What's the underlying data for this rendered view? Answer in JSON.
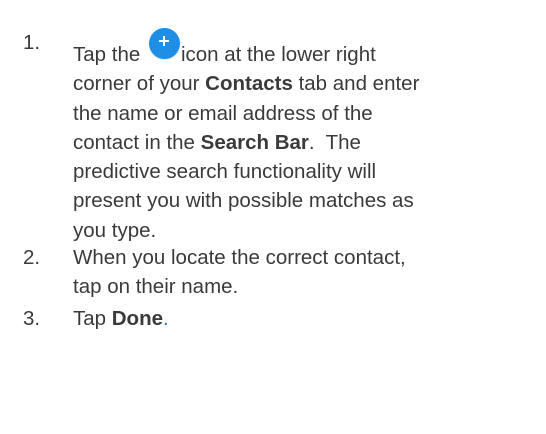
{
  "steps": [
    {
      "number": "1.",
      "lines": [
        {
          "a": "Tap the",
          "b": "icon at the lower right"
        },
        {
          "a": "corner of your ",
          "bold": "Contacts",
          "c": " tab and enter"
        },
        {
          "a": "the name or email address of the"
        },
        {
          "a": "contact in the ",
          "bold": "Search Bar",
          "c": ".  The"
        },
        {
          "a": "predictive search functionality will"
        },
        {
          "a": "present you with possible matches as"
        },
        {
          "a": "you type."
        }
      ],
      "icon": "plus-circle-icon",
      "icon_color": "#1f8ee5"
    },
    {
      "number": "2.",
      "lines": [
        {
          "a": "When you locate the correct contact,"
        },
        {
          "a": "tap on their name."
        }
      ]
    },
    {
      "number": "3.",
      "lines": [
        {
          "a": "Tap ",
          "bold": "Done",
          "period": "."
        }
      ],
      "period_color": "#2a7fc8"
    }
  ]
}
